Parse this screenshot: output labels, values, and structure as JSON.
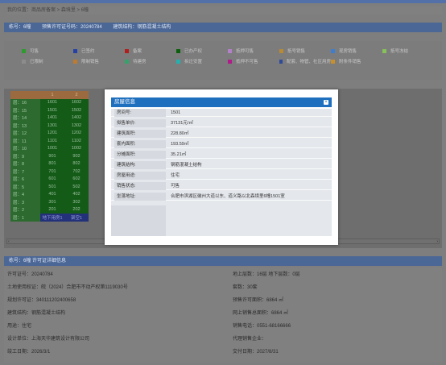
{
  "breadcrumb": {
    "label": "我的位置：",
    "path": "商品房备案 > 森境里 > 6幢"
  },
  "header": {
    "building": "栋号：6幢",
    "permit": "预售许可证号码：20240784",
    "structure": "建筑结构：钢筋混凝土结构"
  },
  "legend": {
    "row1": [
      {
        "label": "可售",
        "color": "#2e9b2e"
      },
      {
        "label": "已签约",
        "color": "#2541a5"
      },
      {
        "label": "备案",
        "color": "#b21d1d"
      },
      {
        "label": "已办产权",
        "color": "#0b5e0b"
      },
      {
        "label": "抵押可售",
        "color": "#b480c8"
      },
      {
        "label": "抵号销售",
        "color": "#b88a32"
      },
      {
        "label": "现房销售",
        "color": "#3f7ecf"
      },
      {
        "label": "抵号冻结",
        "color": "#86c15a"
      }
    ],
    "row2": [
      {
        "label": "已限制",
        "color": "#8c8c8c"
      },
      {
        "label": "限制销售",
        "color": "#c07a30"
      },
      {
        "label": "待建房",
        "color": "#34a36a"
      },
      {
        "label": "拆迁安置",
        "color": "#25b0b0"
      },
      {
        "label": "抵押不可售",
        "color": "#b01a8a"
      },
      {
        "label": "配套、物管、社区用房",
        "color": "#2e4a9b"
      },
      {
        "label": "附条件销售",
        "color": "#c8902a"
      }
    ]
  },
  "grid": {
    "header": [
      "1",
      "2"
    ],
    "floors": [
      {
        "floor": "层：16",
        "u1": "1601",
        "u2": "1602"
      },
      {
        "floor": "层：15",
        "u1": "1501",
        "u2": "1502"
      },
      {
        "floor": "层：14",
        "u1": "1401",
        "u2": "1402"
      },
      {
        "floor": "层：13",
        "u1": "1301",
        "u2": "1302"
      },
      {
        "floor": "层：12",
        "u1": "1201",
        "u2": "1202"
      },
      {
        "floor": "层：11",
        "u1": "1101",
        "u2": "1102"
      },
      {
        "floor": "层：10",
        "u1": "1001",
        "u2": "1002"
      },
      {
        "floor": "层：9",
        "u1": "901",
        "u2": "902"
      },
      {
        "floor": "层：8",
        "u1": "801",
        "u2": "802"
      },
      {
        "floor": "层：7",
        "u1": "701",
        "u2": "702"
      },
      {
        "floor": "层：6",
        "u1": "601",
        "u2": "602"
      },
      {
        "floor": "层：5",
        "u1": "501",
        "u2": "502"
      },
      {
        "floor": "层：4",
        "u1": "401",
        "u2": "402"
      },
      {
        "floor": "层：3",
        "u1": "301",
        "u2": "302"
      },
      {
        "floor": "层：2",
        "u1": "201",
        "u2": "202"
      },
      {
        "floor": "层：1",
        "u1": "地下用房1",
        "u2": "架空1"
      }
    ]
  },
  "modal": {
    "title": "房屋信息",
    "close": "×",
    "fields": [
      {
        "k": "房间号:",
        "v": "1501"
      },
      {
        "k": "拟售单价:",
        "v": "37131元/㎡"
      },
      {
        "k": "建筑面积:",
        "v": "228.80㎡"
      },
      {
        "k": "套内面积:",
        "v": "193.59㎡"
      },
      {
        "k": "分摊面积:",
        "v": "35.21㎡"
      },
      {
        "k": "建筑结构:",
        "v": "钢筋混凝土结构"
      },
      {
        "k": "房屋用途:",
        "v": "住宅"
      },
      {
        "k": "销售状态:",
        "v": "可售"
      },
      {
        "k": "坐落地址:",
        "v": "合肥市滨湖区徽州大道以东、道义路以北森境里6幢1501室"
      }
    ]
  },
  "permit_section": {
    "title": "栋号：6幢 许可证详细信息",
    "rows": [
      {
        "l": "许可证号：20240784",
        "r": "地上层数：16层 地下层数：0层"
      },
      {
        "l": "土地使用权证：皖（2024）合肥市不动产权第1119030号",
        "r": "套数：30套"
      },
      {
        "l": "规划许可证：340111202400658",
        "r": "预售许可面积：6864 ㎡"
      },
      {
        "l": "建筑结构：钢筋混凝土结构",
        "r": "网上销售总面积：6864 ㎡"
      },
      {
        "l": "用途：住宅",
        "r": "销售电话：0551-68166666"
      },
      {
        "l": "设计单位：上海天华建筑设计有限公司",
        "r": "代理销售企业："
      },
      {
        "l": "竣工日期：2026/3/1",
        "r": "交付日期：2027/8/31"
      }
    ]
  }
}
